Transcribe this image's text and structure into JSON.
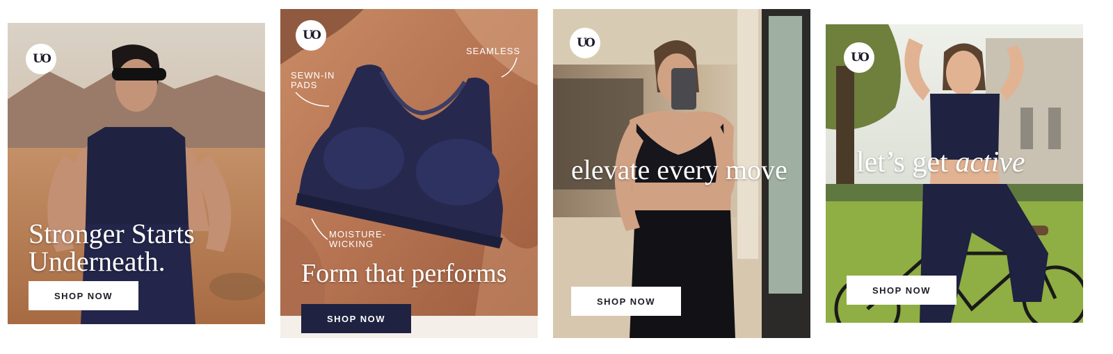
{
  "brand": {
    "logo_text": "UO"
  },
  "cards": [
    {
      "headline": "Stronger Starts Underneath.",
      "headline_line1": "Stronger Starts",
      "headline_line2": "Underneath.",
      "button": "SHOP NOW"
    },
    {
      "headline": "Form that performs",
      "button": "SHOP NOW",
      "callouts": {
        "seamless": "SEAMLESS",
        "pads_line1": "SEWN-IN",
        "pads_line2": "PADS",
        "wicking_line1": "MOISTURE-",
        "wicking_line2": "WICKING"
      }
    },
    {
      "headline": "elevate every move",
      "button": "SHOP NOW"
    },
    {
      "headline_plain": "let’s get",
      "headline_italic": "active",
      "button": "SHOP NOW"
    }
  ],
  "colors": {
    "navy": "#1f2240",
    "white": "#ffffff"
  }
}
